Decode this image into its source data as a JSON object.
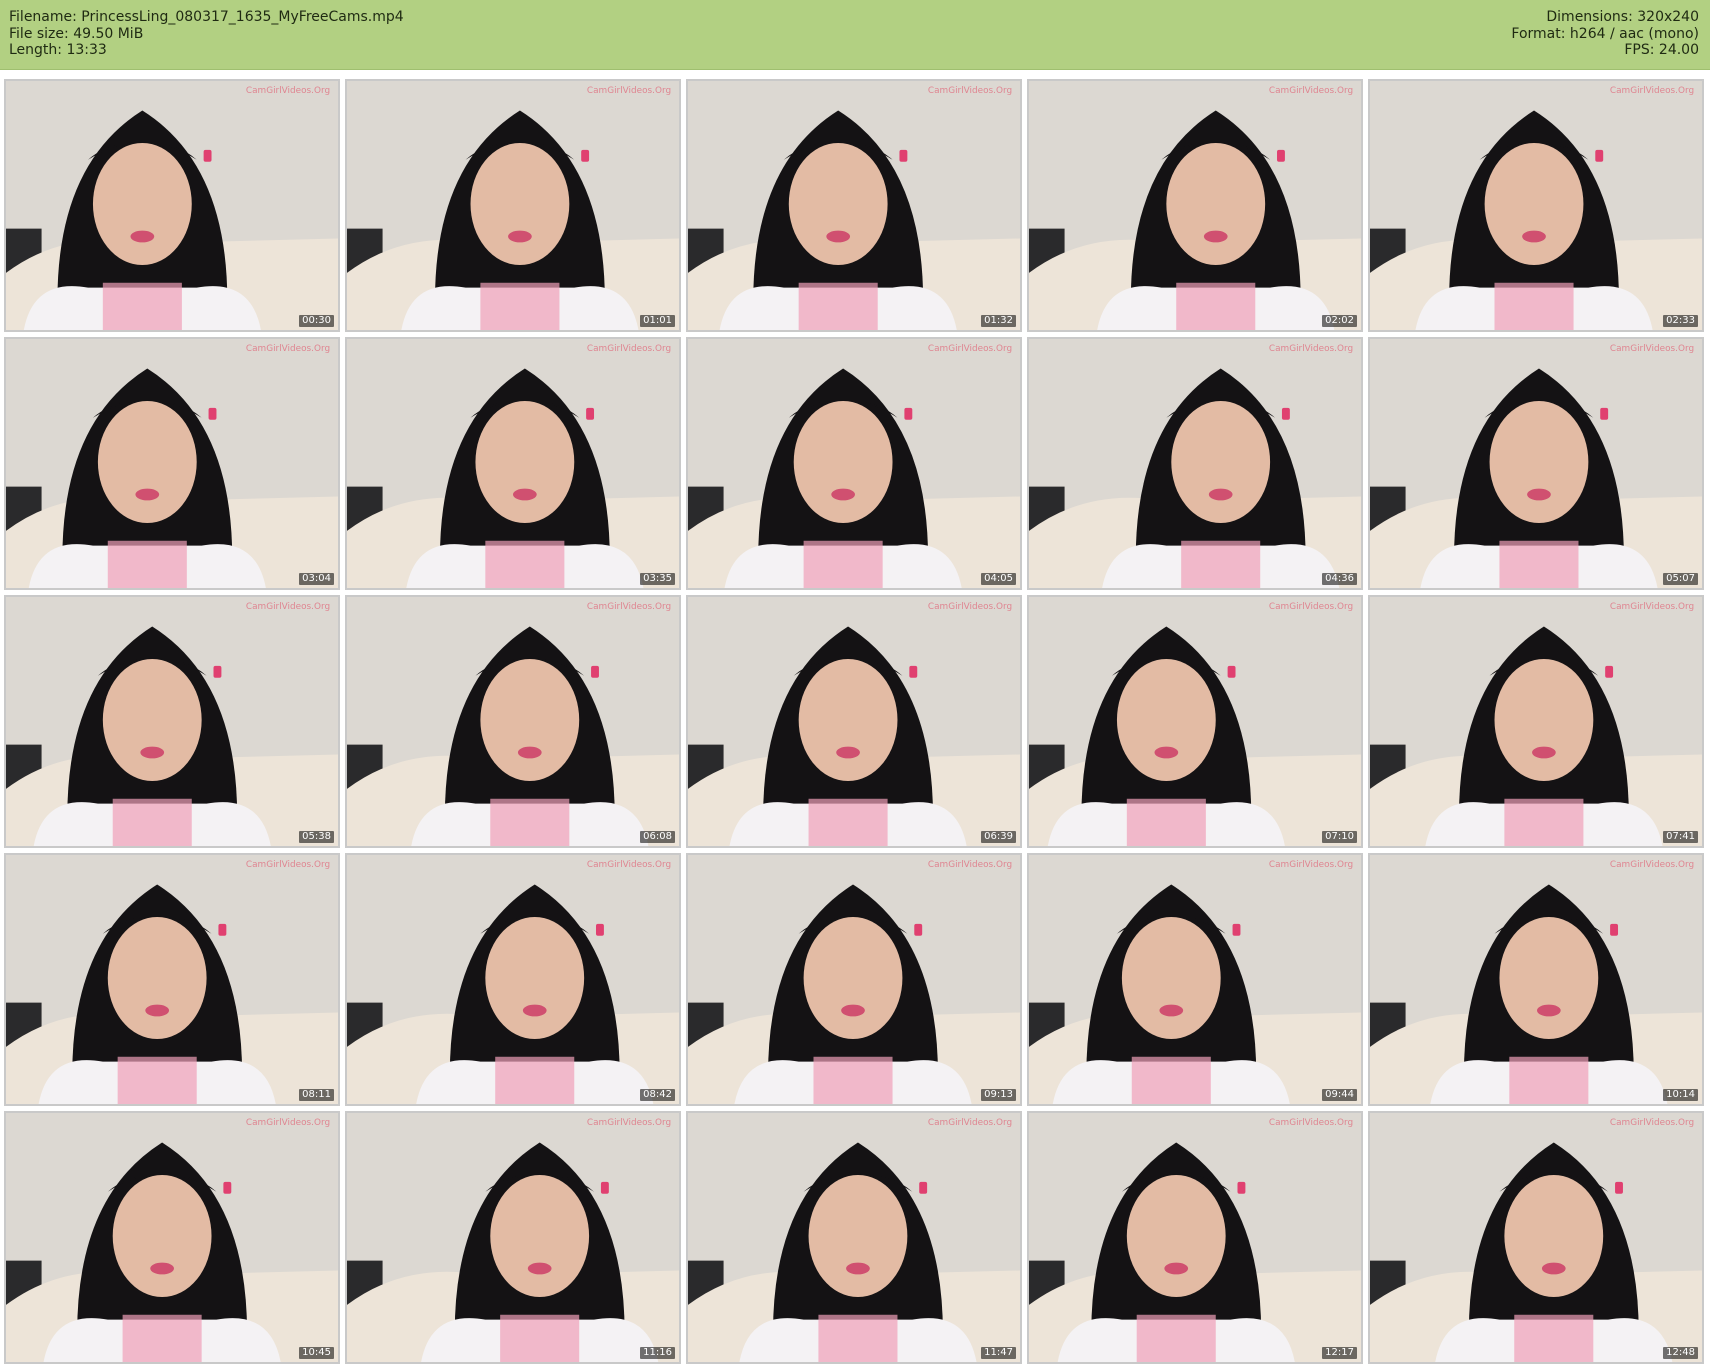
{
  "meta": {
    "filename_line": "Filename: PrincessLing_080317_1635_MyFreeCams.mp4",
    "filesize_line": "File size: 49.50 MiB",
    "length_line": "Length: 13:33",
    "dimensions_line": "Dimensions: 320x240",
    "format_line": "Format: h264 / aac (mono)",
    "fps_line": "FPS: 24.00"
  },
  "colors": {
    "header_bg": "#b2d082",
    "wall": "#dcd8d2",
    "hair": "#141214",
    "skin": "#e3bba4",
    "sofa": "#ede4d8",
    "pink": "#f0a0b8",
    "watermark": "#e07080"
  },
  "thumbnails": [
    {
      "timestamp": "00:30"
    },
    {
      "timestamp": "01:01"
    },
    {
      "timestamp": "01:32"
    },
    {
      "timestamp": "02:02"
    },
    {
      "timestamp": "02:33"
    },
    {
      "timestamp": "03:04"
    },
    {
      "timestamp": "03:35"
    },
    {
      "timestamp": "04:05"
    },
    {
      "timestamp": "04:36"
    },
    {
      "timestamp": "05:07"
    },
    {
      "timestamp": "05:38"
    },
    {
      "timestamp": "06:08"
    },
    {
      "timestamp": "06:39"
    },
    {
      "timestamp": "07:10"
    },
    {
      "timestamp": "07:41"
    },
    {
      "timestamp": "08:11"
    },
    {
      "timestamp": "08:42"
    },
    {
      "timestamp": "09:13"
    },
    {
      "timestamp": "09:44"
    },
    {
      "timestamp": "10:14"
    },
    {
      "timestamp": "10:45"
    },
    {
      "timestamp": "11:16"
    },
    {
      "timestamp": "11:47"
    },
    {
      "timestamp": "12:17"
    },
    {
      "timestamp": "12:48"
    }
  ]
}
